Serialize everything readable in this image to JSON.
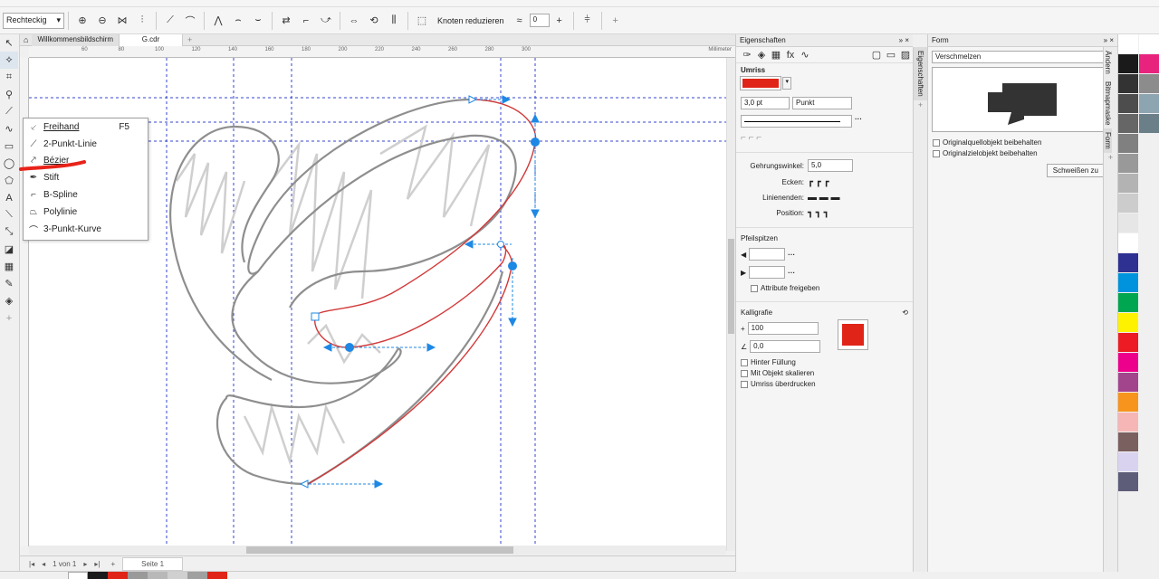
{
  "propbar": {
    "shape_select": "Rechteckig",
    "reduce_nodes": "Knoten reduzieren",
    "smoothing_value": "0"
  },
  "tabs": [
    {
      "label": "Willkommensbildschirm"
    },
    {
      "label": "G.cdr"
    }
  ],
  "ruler": {
    "unit": "Millimeter",
    "labels": [
      "60",
      "80",
      "100",
      "120",
      "140",
      "160",
      "180",
      "200",
      "220",
      "240",
      "260",
      "280",
      "300"
    ]
  },
  "flyout": {
    "items": [
      {
        "label": "Freihand",
        "shortcut": "F5",
        "icon": "freehand-icon"
      },
      {
        "label": "2-Punkt-Linie",
        "shortcut": "",
        "icon": "two-point-line-icon"
      },
      {
        "label": "Bézier",
        "shortcut": "",
        "icon": "bezier-icon"
      },
      {
        "label": "Stift",
        "shortcut": "",
        "icon": "pen-icon"
      },
      {
        "label": "B-Spline",
        "shortcut": "",
        "icon": "b-spline-icon"
      },
      {
        "label": "Polylinie",
        "shortcut": "",
        "icon": "polyline-icon"
      },
      {
        "label": "3-Punkt-Kurve",
        "shortcut": "",
        "icon": "three-point-curve-icon"
      }
    ],
    "highlight_color": "#e8231a"
  },
  "pagebar": {
    "page_of": "1 von 1",
    "page_tab": "Seite 1"
  },
  "properties": {
    "title": "Eigenschaften",
    "outline_heading": "Umriss",
    "outline_color": "#e02418",
    "width_value": "3,0 pt",
    "width_unit": "Punkt",
    "miter_label": "Gehrungswinkel:",
    "miter_value": "5,0",
    "corners_label": "Ecken:",
    "line_ends_label": "Linienenden:",
    "position_label": "Position:",
    "arrowheads_heading": "Pfeilspitzen",
    "share_attributes": "Attribute freigeben",
    "calligraphy_heading": "Kalligrafie",
    "stretch_value": "100",
    "angle_value": "0,0",
    "behind_fill": "Hinter Füllung",
    "scale_with_object": "Mit Objekt skalieren",
    "overprint_outline": "Umriss überdrucken"
  },
  "side_tabs": {
    "properties_tab": "Eigenschaften",
    "change_tab": "Ändern",
    "bitmap_mask_tab": "Bitmapmaske",
    "form_tab": "Form"
  },
  "form": {
    "title": "Form",
    "mode": "Verschmelzen",
    "keep_source": "Originalquellobjekt beibehalten",
    "keep_target": "Originalzielobjekt beibehalten",
    "weld_button": "Schweißen zu"
  },
  "palette": {
    "colors": [
      "#ffffff",
      "#1a1a1a",
      "#333333",
      "#4d4d4d",
      "#666666",
      "#808080",
      "#999999",
      "#b3b3b3",
      "#cccccc",
      "#e6e6e6",
      "#ffffff",
      "#2e3192",
      "#0093dd",
      "#00a650",
      "#fff200",
      "#ed1c24",
      "#ec008c",
      "#a3458d",
      "#f7941d",
      "#f7b6b6",
      "#7b6060",
      "#d9d3f0",
      "#5d5d7a"
    ],
    "col2_colors": [
      "#ffffff",
      "#e8237e",
      "#8c8c8c",
      "#8da5b0",
      "#6b7f89"
    ]
  }
}
